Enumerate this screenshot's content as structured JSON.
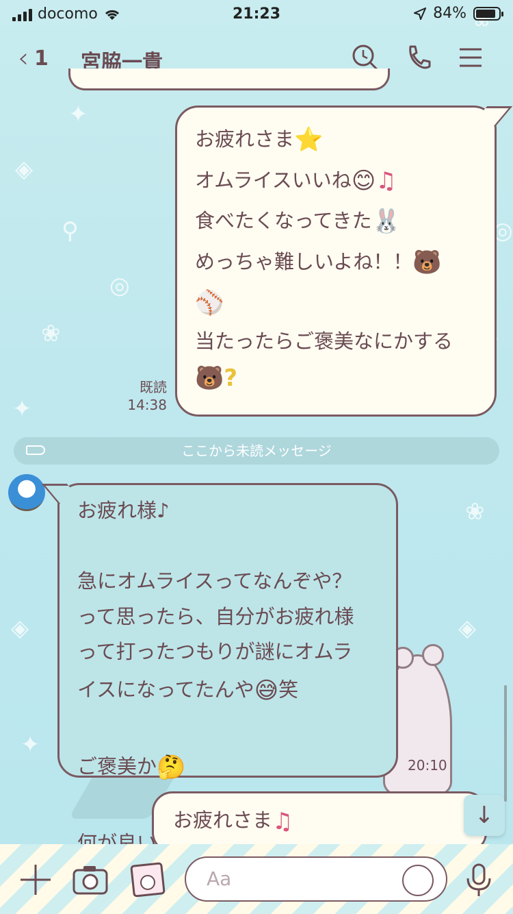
{
  "status_bar": {
    "carrier": "docomo",
    "time": "21:23",
    "battery_percent": "84%"
  },
  "header": {
    "back_count": "1",
    "title": "宮脇一貴"
  },
  "messages": {
    "sent_1": {
      "lines": [
        "お疲れさま",
        "オムライスいいね",
        "食べたくなってきた",
        "",
        "めっちゃ難しいよね！！",
        "",
        "当たったらご褒美なにかする",
        ""
      ],
      "read_label": "既読",
      "time": "14:38"
    },
    "unread_divider": "ここから未読メッセージ",
    "received_1": {
      "lines": [
        "お疲れ様♪",
        "",
        "急にオムライスってなんぞや？",
        "って思ったら、自分がお疲れ様",
        "って打ったつもりが謎にオムラ",
        "イスになってたんや",
        "",
        "ご褒美か",
        "",
        "何が良いかなー？"
      ],
      "suffix_after_emoji_line6": "笑",
      "time": "20:10"
    },
    "sent_2": {
      "text": "お疲れさま"
    }
  },
  "input": {
    "placeholder": "Aa"
  },
  "colors": {
    "background": "#bfe8ee",
    "sent_bubble": "#fffdf2",
    "received_bubble": "#bde5e8",
    "bubble_border": "#7a5a62",
    "text": "#6a4b52"
  }
}
